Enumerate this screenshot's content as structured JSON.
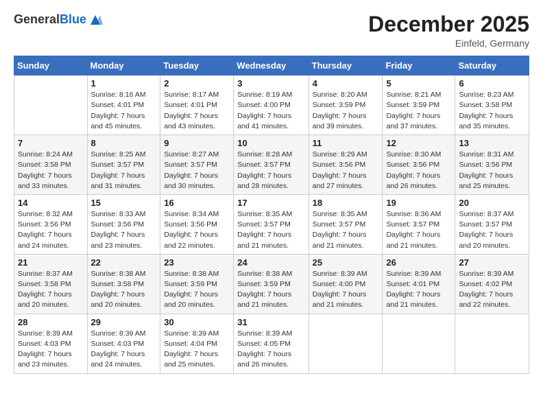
{
  "logo": {
    "general": "General",
    "blue": "Blue"
  },
  "title": "December 2025",
  "location": "Einfeld, Germany",
  "weekdays": [
    "Sunday",
    "Monday",
    "Tuesday",
    "Wednesday",
    "Thursday",
    "Friday",
    "Saturday"
  ],
  "weeks": [
    [
      {
        "day": "",
        "info": ""
      },
      {
        "day": "1",
        "info": "Sunrise: 8:16 AM\nSunset: 4:01 PM\nDaylight: 7 hours\nand 45 minutes."
      },
      {
        "day": "2",
        "info": "Sunrise: 8:17 AM\nSunset: 4:01 PM\nDaylight: 7 hours\nand 43 minutes."
      },
      {
        "day": "3",
        "info": "Sunrise: 8:19 AM\nSunset: 4:00 PM\nDaylight: 7 hours\nand 41 minutes."
      },
      {
        "day": "4",
        "info": "Sunrise: 8:20 AM\nSunset: 3:59 PM\nDaylight: 7 hours\nand 39 minutes."
      },
      {
        "day": "5",
        "info": "Sunrise: 8:21 AM\nSunset: 3:59 PM\nDaylight: 7 hours\nand 37 minutes."
      },
      {
        "day": "6",
        "info": "Sunrise: 8:23 AM\nSunset: 3:58 PM\nDaylight: 7 hours\nand 35 minutes."
      }
    ],
    [
      {
        "day": "7",
        "info": "Sunrise: 8:24 AM\nSunset: 3:58 PM\nDaylight: 7 hours\nand 33 minutes."
      },
      {
        "day": "8",
        "info": "Sunrise: 8:25 AM\nSunset: 3:57 PM\nDaylight: 7 hours\nand 31 minutes."
      },
      {
        "day": "9",
        "info": "Sunrise: 8:27 AM\nSunset: 3:57 PM\nDaylight: 7 hours\nand 30 minutes."
      },
      {
        "day": "10",
        "info": "Sunrise: 8:28 AM\nSunset: 3:57 PM\nDaylight: 7 hours\nand 28 minutes."
      },
      {
        "day": "11",
        "info": "Sunrise: 8:29 AM\nSunset: 3:56 PM\nDaylight: 7 hours\nand 27 minutes."
      },
      {
        "day": "12",
        "info": "Sunrise: 8:30 AM\nSunset: 3:56 PM\nDaylight: 7 hours\nand 26 minutes."
      },
      {
        "day": "13",
        "info": "Sunrise: 8:31 AM\nSunset: 3:56 PM\nDaylight: 7 hours\nand 25 minutes."
      }
    ],
    [
      {
        "day": "14",
        "info": "Sunrise: 8:32 AM\nSunset: 3:56 PM\nDaylight: 7 hours\nand 24 minutes."
      },
      {
        "day": "15",
        "info": "Sunrise: 8:33 AM\nSunset: 3:56 PM\nDaylight: 7 hours\nand 23 minutes."
      },
      {
        "day": "16",
        "info": "Sunrise: 8:34 AM\nSunset: 3:56 PM\nDaylight: 7 hours\nand 22 minutes."
      },
      {
        "day": "17",
        "info": "Sunrise: 8:35 AM\nSunset: 3:57 PM\nDaylight: 7 hours\nand 21 minutes."
      },
      {
        "day": "18",
        "info": "Sunrise: 8:35 AM\nSunset: 3:57 PM\nDaylight: 7 hours\nand 21 minutes."
      },
      {
        "day": "19",
        "info": "Sunrise: 8:36 AM\nSunset: 3:57 PM\nDaylight: 7 hours\nand 21 minutes."
      },
      {
        "day": "20",
        "info": "Sunrise: 8:37 AM\nSunset: 3:57 PM\nDaylight: 7 hours\nand 20 minutes."
      }
    ],
    [
      {
        "day": "21",
        "info": "Sunrise: 8:37 AM\nSunset: 3:58 PM\nDaylight: 7 hours\nand 20 minutes."
      },
      {
        "day": "22",
        "info": "Sunrise: 8:38 AM\nSunset: 3:58 PM\nDaylight: 7 hours\nand 20 minutes."
      },
      {
        "day": "23",
        "info": "Sunrise: 8:38 AM\nSunset: 3:59 PM\nDaylight: 7 hours\nand 20 minutes."
      },
      {
        "day": "24",
        "info": "Sunrise: 8:38 AM\nSunset: 3:59 PM\nDaylight: 7 hours\nand 21 minutes."
      },
      {
        "day": "25",
        "info": "Sunrise: 8:39 AM\nSunset: 4:00 PM\nDaylight: 7 hours\nand 21 minutes."
      },
      {
        "day": "26",
        "info": "Sunrise: 8:39 AM\nSunset: 4:01 PM\nDaylight: 7 hours\nand 21 minutes."
      },
      {
        "day": "27",
        "info": "Sunrise: 8:39 AM\nSunset: 4:02 PM\nDaylight: 7 hours\nand 22 minutes."
      }
    ],
    [
      {
        "day": "28",
        "info": "Sunrise: 8:39 AM\nSunset: 4:03 PM\nDaylight: 7 hours\nand 23 minutes."
      },
      {
        "day": "29",
        "info": "Sunrise: 8:39 AM\nSunset: 4:03 PM\nDaylight: 7 hours\nand 24 minutes."
      },
      {
        "day": "30",
        "info": "Sunrise: 8:39 AM\nSunset: 4:04 PM\nDaylight: 7 hours\nand 25 minutes."
      },
      {
        "day": "31",
        "info": "Sunrise: 8:39 AM\nSunset: 4:05 PM\nDaylight: 7 hours\nand 26 minutes."
      },
      {
        "day": "",
        "info": ""
      },
      {
        "day": "",
        "info": ""
      },
      {
        "day": "",
        "info": ""
      }
    ]
  ]
}
